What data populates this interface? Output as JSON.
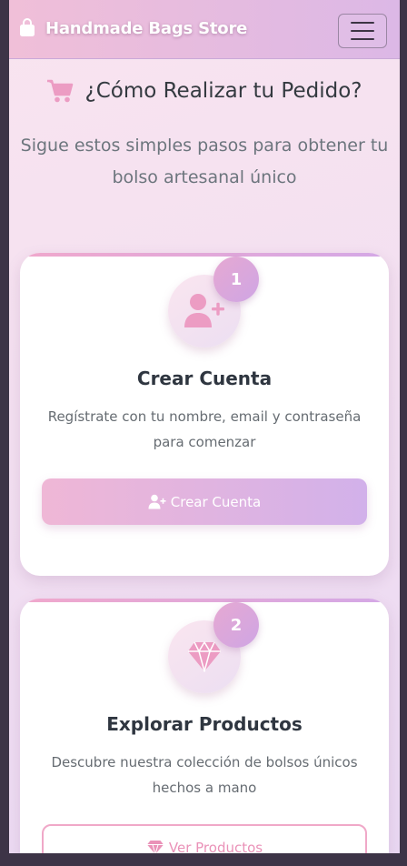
{
  "navbar": {
    "brand_icon": "shopping-bag-icon",
    "brand": "Handmade Bags Store",
    "toggle_icon": "hamburger-menu-icon"
  },
  "header": {
    "icon": "shopping-cart-icon",
    "title": "¿Cómo Realizar tu Pedido?",
    "subtitle": "Sigue estos simples pasos para obtener tu bolso artesanal único"
  },
  "steps": [
    {
      "number": "1",
      "icon": "user-plus-icon",
      "title": "Crear Cuenta",
      "description": "Regístrate con tu nombre, email y contraseña para comenzar",
      "button_icon": "user-plus-icon",
      "button_label": "Crear Cuenta"
    },
    {
      "number": "2",
      "icon": "gem-icon",
      "title": "Explorar Productos",
      "description": "Descubre nuestra colección de bolsos únicos hechos a mano",
      "button_icon": "gem-icon",
      "button_label": "Ver Productos"
    }
  ],
  "colors": {
    "accent_pink": "#efb7d6",
    "accent_purple": "#d2b1ea",
    "icon_pink": "#ec9cc3",
    "heading_text": "#343a40",
    "muted_text": "#6c757d"
  }
}
